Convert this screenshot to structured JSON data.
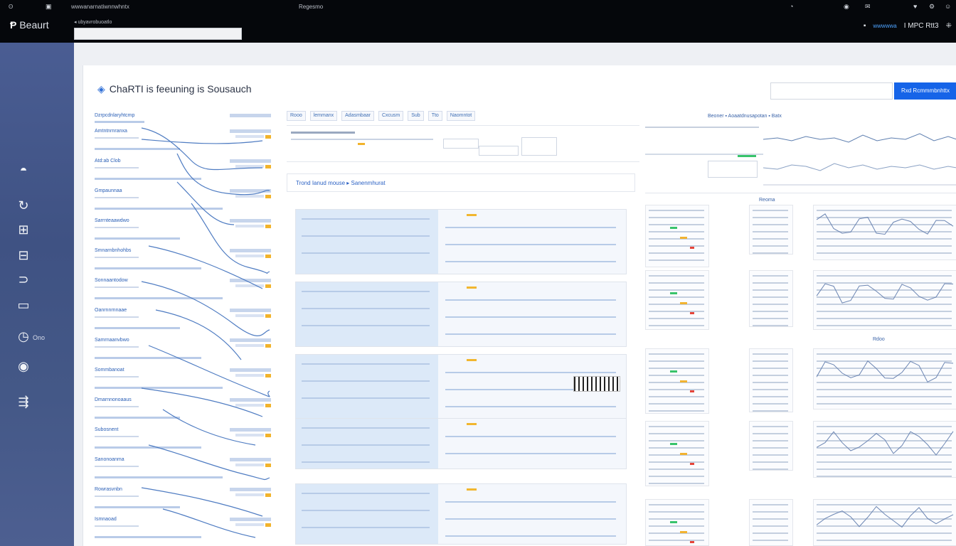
{
  "topbar": {
    "left_label": "wwwanarnatiwnnwhntx",
    "center_label": "Regesmo",
    "brand_name": "Beaurt",
    "url_label": "ubyavrobuoatlo",
    "right_items": [
      "wwwwwa",
      "I MPC Rtt3",
      "▪"
    ]
  },
  "main": {
    "title": "ChaRTI is feeuning is Sousauch",
    "search_placeholder": "",
    "action_button": "Rxd Rcmmmbnhttx"
  },
  "sidebar": {
    "items": [
      {
        "icon": "gauge-icon",
        "label": ""
      },
      {
        "icon": "check-circle-icon",
        "label": ""
      },
      {
        "icon": "grid-icon",
        "label": ""
      },
      {
        "icon": "card-icon",
        "label": ""
      },
      {
        "icon": "stack-icon",
        "label": ""
      },
      {
        "icon": "folder-icon",
        "label": ""
      },
      {
        "icon": "clock-icon",
        "label": "Ono"
      },
      {
        "icon": "circle-dot-icon",
        "label": ""
      },
      {
        "icon": "routes-icon",
        "label": ""
      }
    ]
  },
  "left_list": {
    "header": "Dzrpcdnlaryhtcmp",
    "rows": [
      "Amtntnrnranxa",
      "Atd:ab Clob",
      "Gmpaunnaa",
      "Sarrnteaawdwo",
      "Smnarnbnhohbs",
      "Sonnaantodow",
      "Oanrnnrnnaae",
      "Samrnaanvbwo",
      "Sommbanoat",
      "Dmarnnonoaaus",
      "Subosnent",
      "Sanonoanma",
      "Rowrasvnbn",
      "Ismnaoad"
    ]
  },
  "mid": {
    "tabs": [
      "Rooo",
      "lemmanx",
      "Adasmbaar",
      "Cxcusm",
      "Sub",
      "Tto",
      "Naomntot"
    ],
    "link_text": "Trond Ianud mouse  ▸ Sanenmhurat"
  },
  "right": {
    "top_label": "Beoner  ▪ Aoaatdnusapotan  ▪ Batx",
    "mid_label": "Reoma",
    "lower_label": "Rdoo"
  }
}
